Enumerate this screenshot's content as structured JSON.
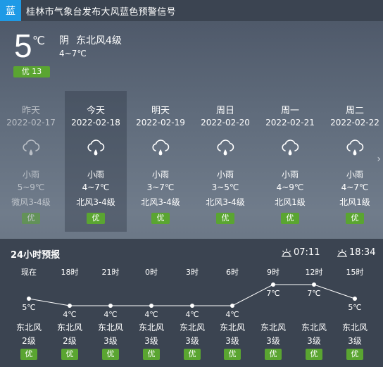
{
  "alert": {
    "badge": "蓝",
    "text": "桂林市气象台发布大风蓝色预警信号",
    "badge_color": "#1e9ae6"
  },
  "current": {
    "temp": "5",
    "unit": "℃",
    "condition": "阴",
    "wind": "东北风4级",
    "range": "4~7℃",
    "aqi": "优 13"
  },
  "daily": [
    {
      "name": "昨天",
      "date": "2022-02-17",
      "icon": "light-rain-icon",
      "cond": "小雨",
      "range": "5~9℃",
      "wind": "微风3-4级",
      "aqi": "优",
      "past": true
    },
    {
      "name": "今天",
      "date": "2022-02-18",
      "icon": "light-rain-icon",
      "cond": "小雨",
      "range": "4~7℃",
      "wind": "北风3-4级",
      "aqi": "优",
      "today": true
    },
    {
      "name": "明天",
      "date": "2022-02-19",
      "icon": "light-rain-icon",
      "cond": "小雨",
      "range": "3~7℃",
      "wind": "北风3-4级",
      "aqi": "优"
    },
    {
      "name": "周日",
      "date": "2022-02-20",
      "icon": "light-rain-icon",
      "cond": "小雨",
      "range": "3~5℃",
      "wind": "北风3-4级",
      "aqi": "优"
    },
    {
      "name": "周一",
      "date": "2022-02-21",
      "icon": "light-rain-icon",
      "cond": "小雨",
      "range": "4~9℃",
      "wind": "北风1级",
      "aqi": "优"
    },
    {
      "name": "周二",
      "date": "2022-02-22",
      "icon": "light-rain-icon",
      "cond": "小雨",
      "range": "4~7℃",
      "wind": "北风1级",
      "aqi": "优"
    }
  ],
  "hourly": {
    "title": "24小时预报",
    "sunrise": "07:11",
    "sunset": "18:34",
    "items": [
      {
        "time": "现在",
        "temp": 5,
        "temp_label": "5℃",
        "wind": "东北风",
        "level": "2级",
        "aqi": "优"
      },
      {
        "time": "18时",
        "temp": 4,
        "temp_label": "4℃",
        "wind": "东北风",
        "level": "2级",
        "aqi": "优"
      },
      {
        "time": "21时",
        "temp": 4,
        "temp_label": "4℃",
        "wind": "东北风",
        "level": "3级",
        "aqi": "优"
      },
      {
        "time": "0时",
        "temp": 4,
        "temp_label": "4℃",
        "wind": "东北风",
        "level": "3级",
        "aqi": "优"
      },
      {
        "time": "3时",
        "temp": 4,
        "temp_label": "4℃",
        "wind": "东北风",
        "level": "3级",
        "aqi": "优"
      },
      {
        "time": "6时",
        "temp": 4,
        "temp_label": "4℃",
        "wind": "东北风",
        "level": "3级",
        "aqi": "优"
      },
      {
        "time": "9时",
        "temp": 7,
        "temp_label": "7℃",
        "wind": "东北风",
        "level": "3级",
        "aqi": "优"
      },
      {
        "time": "12时",
        "temp": 7,
        "temp_label": "7℃",
        "wind": "东北风",
        "level": "3级",
        "aqi": "优"
      },
      {
        "time": "15时",
        "temp": 5,
        "temp_label": "5℃",
        "wind": "东北风",
        "level": "3级",
        "aqi": "优"
      }
    ]
  },
  "colors": {
    "aqi_good": "#5aa531",
    "panel": "#3b4451"
  }
}
